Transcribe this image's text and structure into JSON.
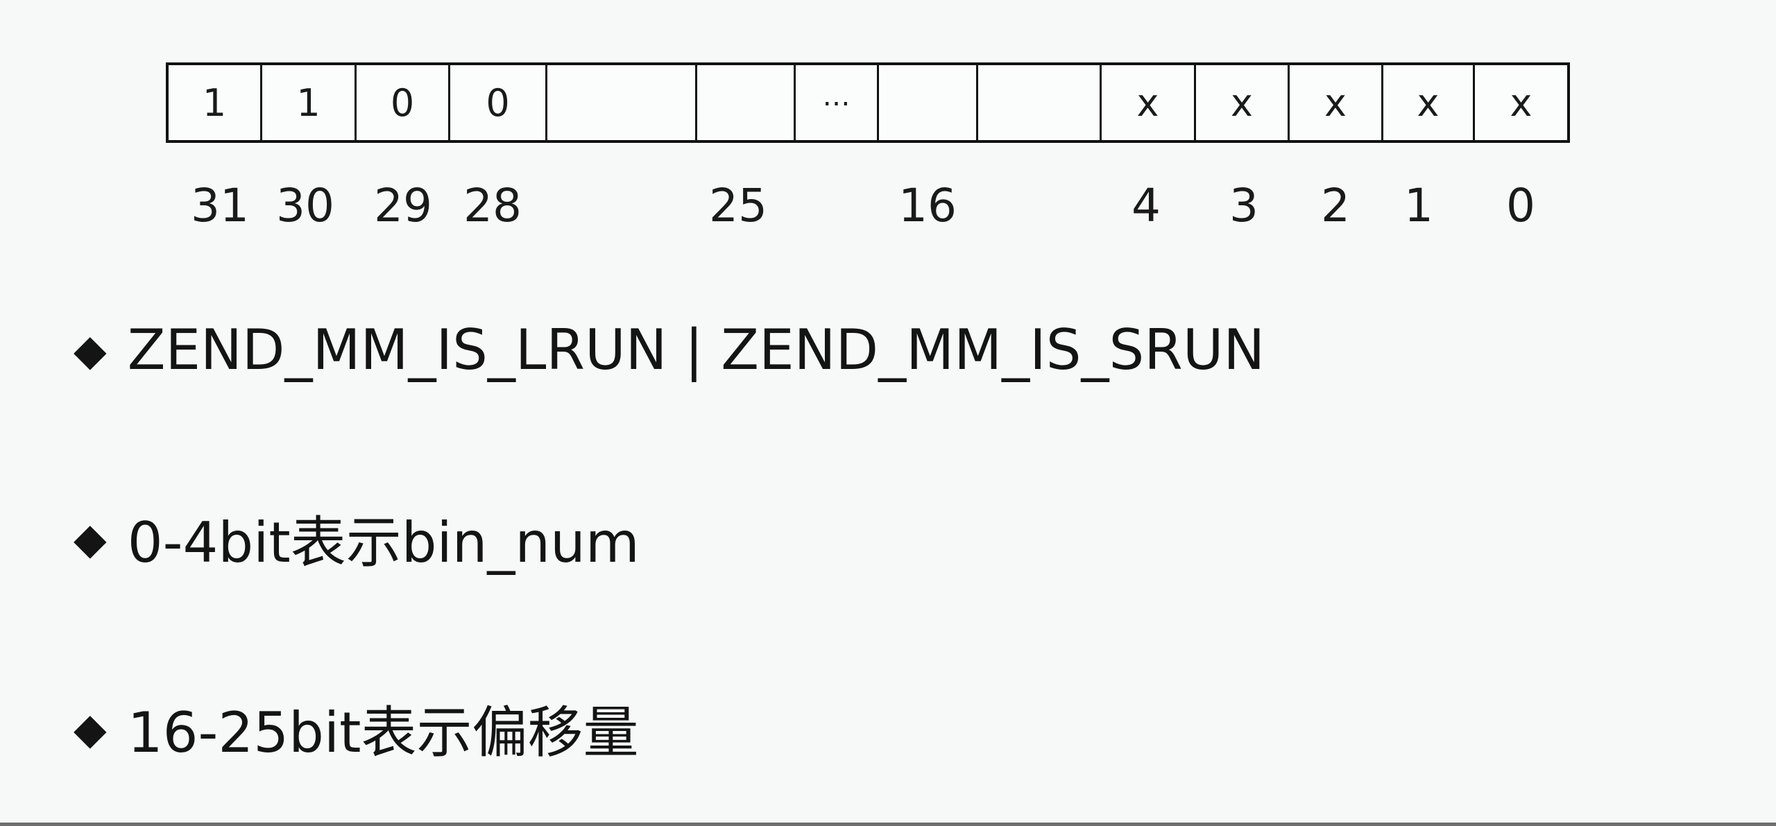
{
  "register": {
    "cells": [
      "1",
      "1",
      "0",
      "0",
      "",
      "",
      "…",
      "",
      "",
      "x",
      "x",
      "x",
      "x",
      "x"
    ],
    "bit_labels": [
      "31",
      "30",
      "29",
      "28",
      "25",
      "16",
      "4",
      "3",
      "2",
      "1",
      "0"
    ]
  },
  "bullets": [
    "ZEND_MM_IS_LRUN | ZEND_MM_IS_SRUN",
    "0-4bit表示bin_num",
    "16-25bit表示偏移量"
  ]
}
